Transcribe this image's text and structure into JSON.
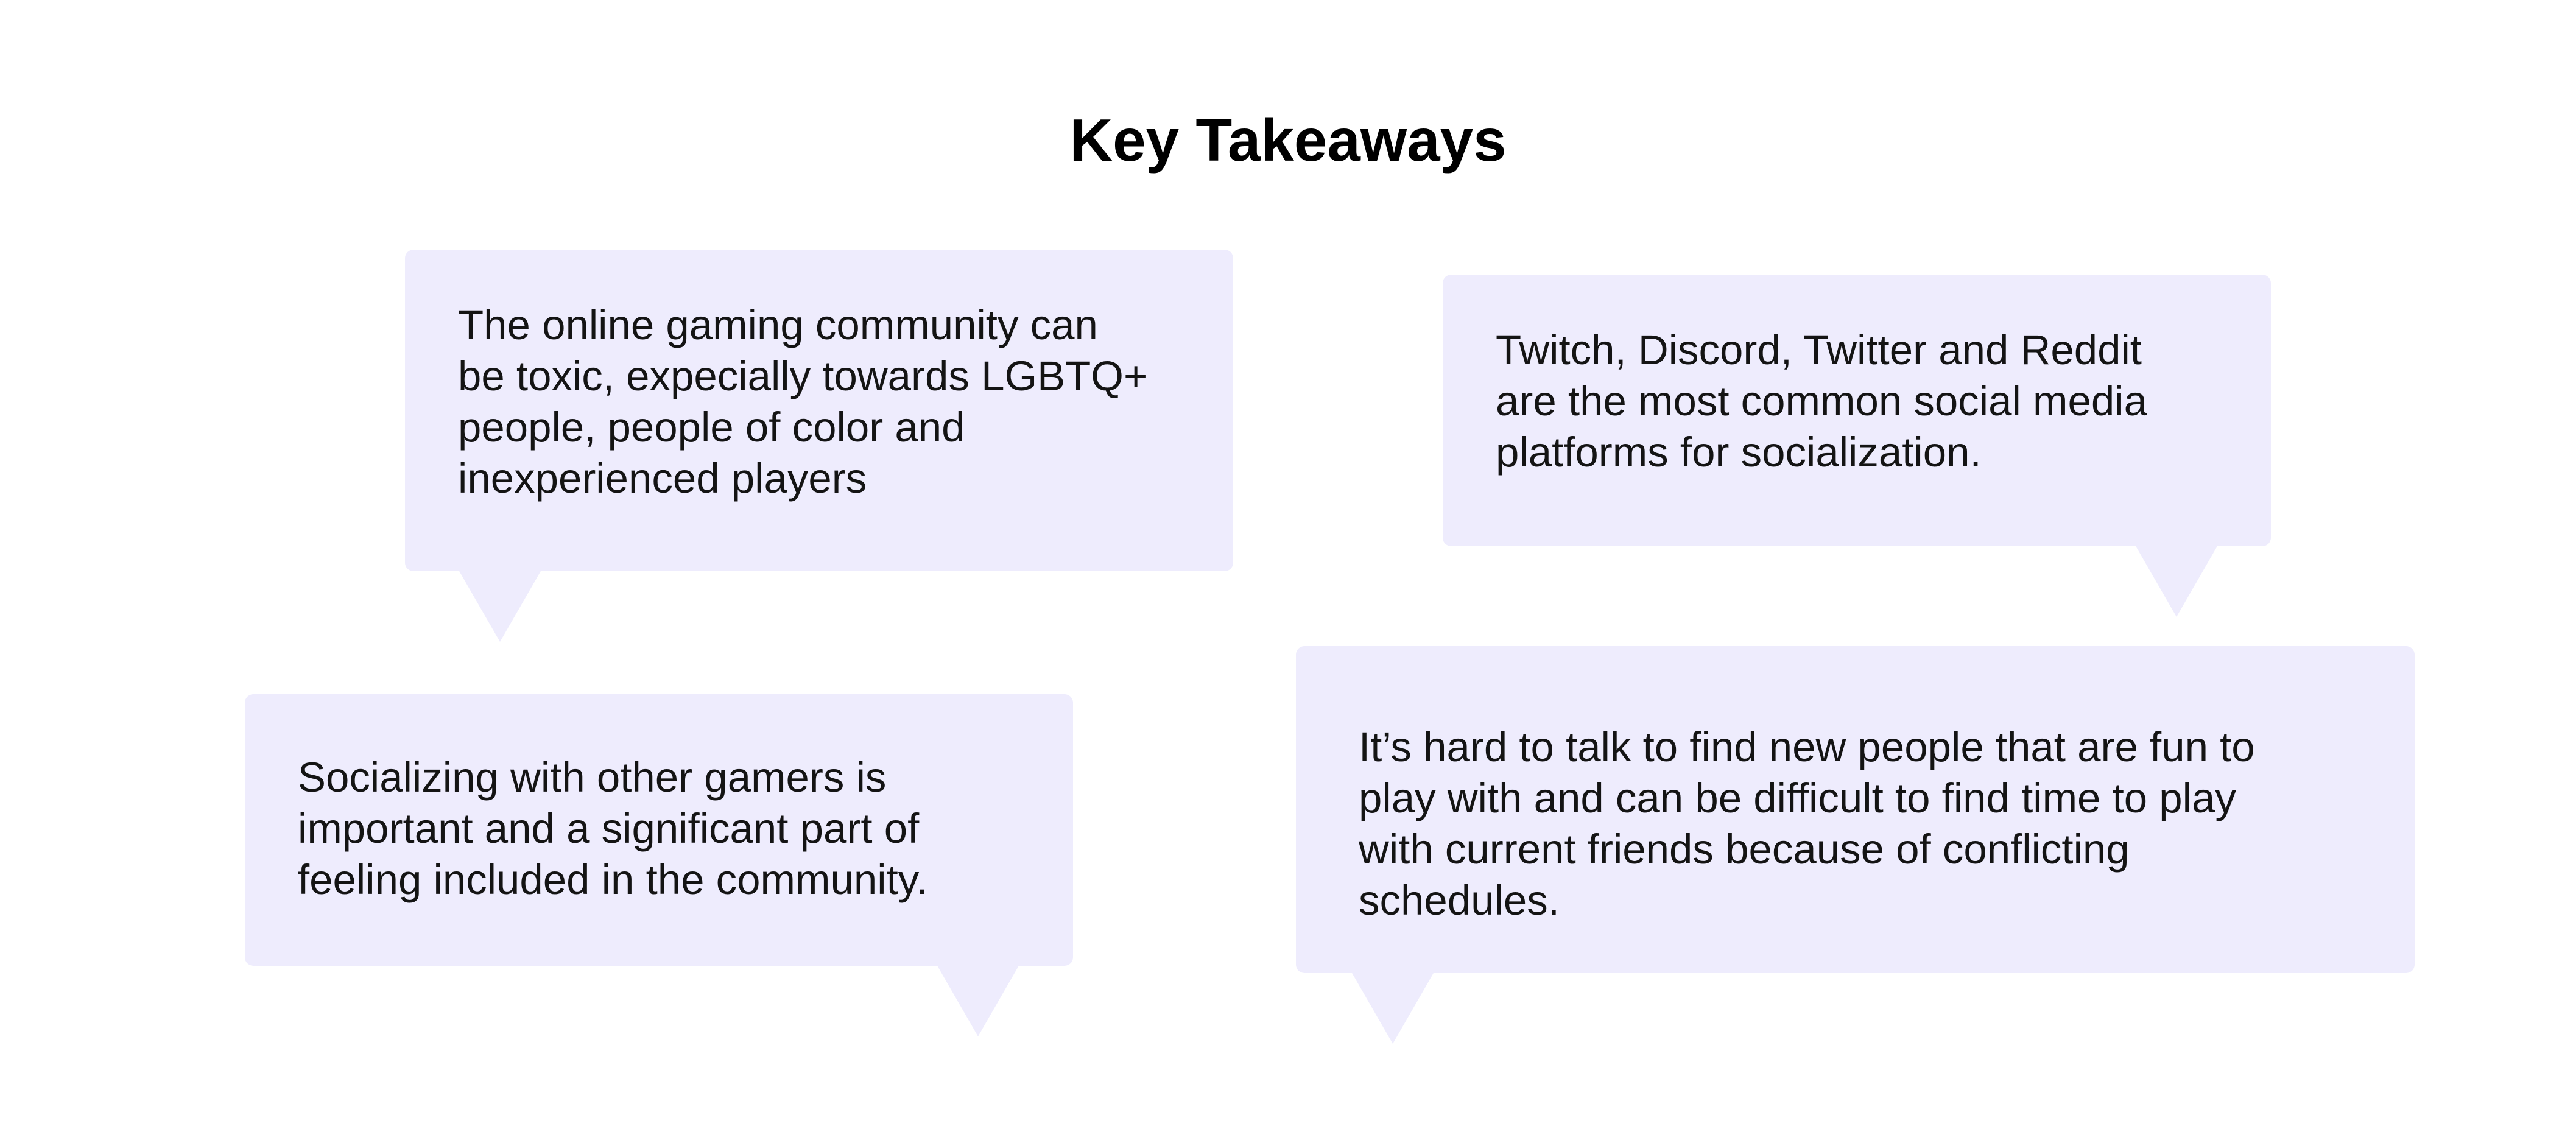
{
  "page": {
    "title": "Key Takeaways"
  },
  "takeaways": [
    {
      "lines": [
        "The online gaming community can",
        "be toxic, expecially towards LGBTQ+",
        "people, people of color and",
        "inexperienced players"
      ]
    },
    {
      "lines": [
        "Twitch, Discord, Twitter and Reddit",
        "are the most common social media",
        "platforms for socialization."
      ]
    },
    {
      "lines": [
        "Socializing with other gamers is",
        "important and a significant part of",
        "feeling included in the community."
      ]
    },
    {
      "lines": [
        "It’s hard to talk to find new people that are fun to",
        "play with and can be difficult to find time to play",
        "with current friends because of conflicting",
        "schedules."
      ]
    }
  ],
  "colors": {
    "bubble_background": "#eeecfd",
    "title_text": "#000000",
    "body_text": "#141414"
  }
}
